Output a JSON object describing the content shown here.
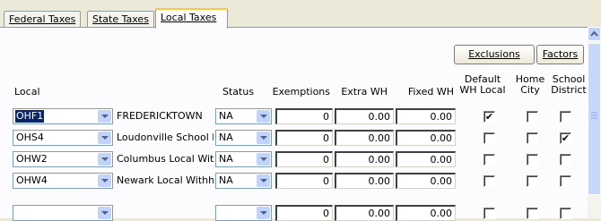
{
  "tabs": [
    {
      "label": "Federal Taxes",
      "active": false
    },
    {
      "label": "State Taxes",
      "active": false
    },
    {
      "label": "Local Taxes",
      "active": true
    }
  ],
  "buttons": {
    "exclusions": "Exclusions",
    "factors": "Factors"
  },
  "columns": {
    "local": "Local",
    "status": "Status",
    "exemptions": "Exemptions",
    "extra_wh": "Extra WH",
    "fixed_wh": "Fixed WH",
    "default_wh_local_1": "Default",
    "default_wh_local_2": "WH Local",
    "home_city_1": "Home",
    "home_city_2": "City",
    "school_district_1": "School",
    "school_district_2": "District"
  },
  "rows": [
    {
      "local": "OHF1",
      "desc": "FREDERICKTOWN",
      "status": "NA",
      "exemptions": "0",
      "extra_wh": "0.00",
      "fixed_wh": "0.00",
      "default_wh_local": true,
      "home_city": false,
      "school_district": false
    },
    {
      "local": "OHS4",
      "desc": "Loudonville School D",
      "status": "NA",
      "exemptions": "0",
      "extra_wh": "0.00",
      "fixed_wh": "0.00",
      "default_wh_local": false,
      "home_city": false,
      "school_district": true
    },
    {
      "local": "OHW2",
      "desc": "Columbus Local With",
      "status": "NA",
      "exemptions": "0",
      "extra_wh": "0.00",
      "fixed_wh": "0.00",
      "default_wh_local": false,
      "home_city": false,
      "school_district": false
    },
    {
      "local": "OHW4",
      "desc": "Newark Local Withh",
      "status": "NA",
      "exemptions": "0",
      "extra_wh": "0.00",
      "fixed_wh": "0.00",
      "default_wh_local": false,
      "home_city": false,
      "school_district": false
    },
    {
      "local": "",
      "desc": "",
      "status": "",
      "exemptions": "0",
      "extra_wh": "0.00",
      "fixed_wh": "0.00",
      "default_wh_local": false,
      "home_city": false,
      "school_district": false
    }
  ],
  "colors": {
    "selection": "#0a246a",
    "tab_accent": "#ffc83c",
    "background": "#ece9d8"
  }
}
